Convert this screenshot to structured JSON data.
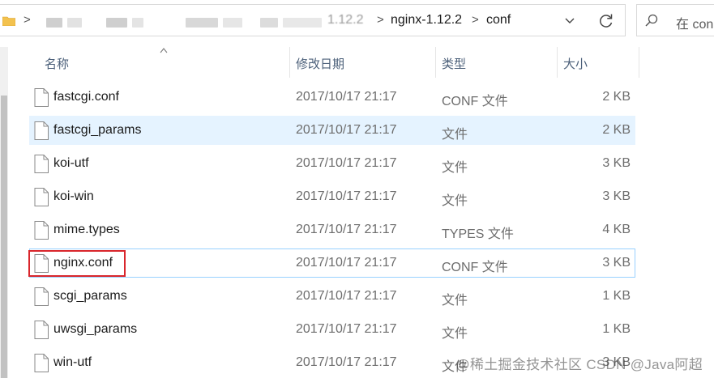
{
  "address_bar": {
    "crumbs": [
      "nginx-1.12.2",
      "conf"
    ],
    "ghost_version": "1.12.2",
    "separator": ">"
  },
  "search": {
    "placeholder": "在 con"
  },
  "columns": {
    "name": "名称",
    "date": "修改日期",
    "type": "类型",
    "size": "大小"
  },
  "files": [
    {
      "name": "fastcgi.conf",
      "date": "2017/10/17 21:17",
      "type": "CONF 文件",
      "size": "2 KB"
    },
    {
      "name": "fastcgi_params",
      "date": "2017/10/17 21:17",
      "type": "文件",
      "size": "2 KB"
    },
    {
      "name": "koi-utf",
      "date": "2017/10/17 21:17",
      "type": "文件",
      "size": "3 KB"
    },
    {
      "name": "koi-win",
      "date": "2017/10/17 21:17",
      "type": "文件",
      "size": "3 KB"
    },
    {
      "name": "mime.types",
      "date": "2017/10/17 21:17",
      "type": "TYPES 文件",
      "size": "4 KB"
    },
    {
      "name": "nginx.conf",
      "date": "2017/10/17 21:17",
      "type": "CONF 文件",
      "size": "3 KB"
    },
    {
      "name": "scgi_params",
      "date": "2017/10/17 21:17",
      "type": "文件",
      "size": "1 KB"
    },
    {
      "name": "uwsgi_params",
      "date": "2017/10/17 21:17",
      "type": "文件",
      "size": "1 KB"
    },
    {
      "name": "win-utf",
      "date": "2017/10/17 21:17",
      "type": "文件",
      "size": "3 KB"
    }
  ],
  "watermark": "@稀土掘金技术社区 CSDN @Java阿超",
  "colors": {
    "selection": "#e5f3ff",
    "hover_border": "#99d1ff",
    "highlight_box": "#d9262c",
    "header_text": "#4c607a"
  }
}
